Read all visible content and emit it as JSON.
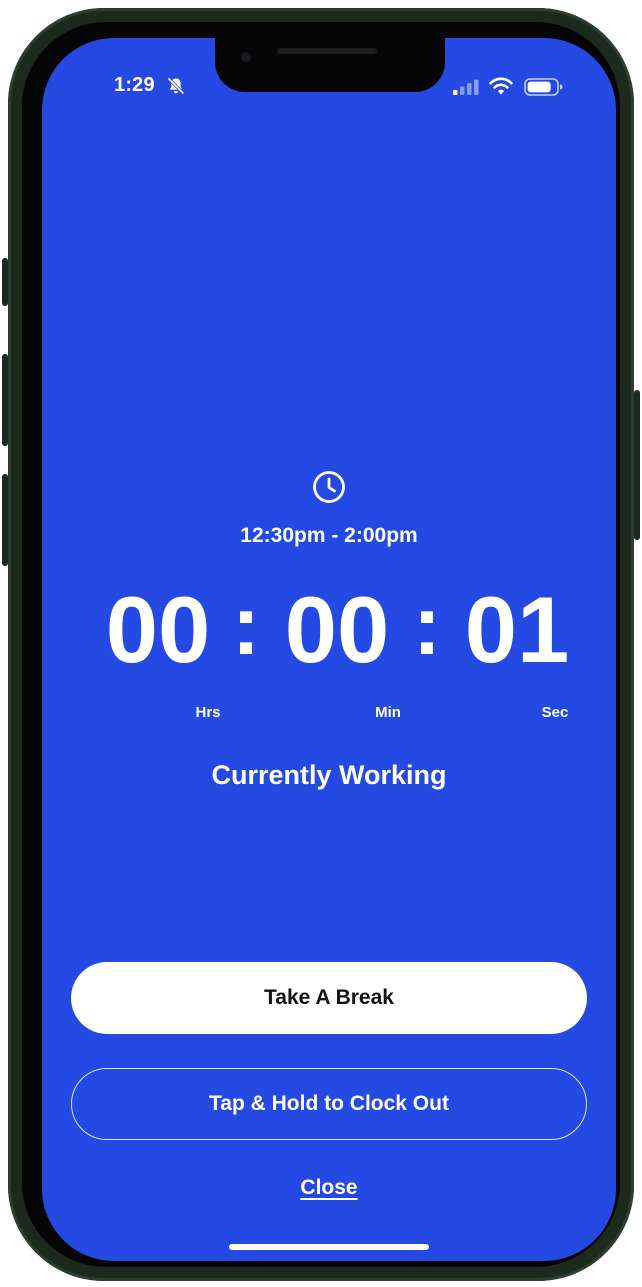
{
  "status_bar": {
    "time": "1:29",
    "icons": [
      "bell-slash-icon",
      "cellular-signal-icon",
      "wifi-icon",
      "battery-icon"
    ]
  },
  "shift": {
    "icon": "clock-icon",
    "schedule": "12:30pm - 2:00pm"
  },
  "timer": {
    "hours": "00",
    "minutes": "00",
    "seconds": "01",
    "separator": ":",
    "hours_label": "Hrs",
    "minutes_label": "Min",
    "seconds_label": "Sec"
  },
  "state_label": "Currently Working",
  "actions": {
    "break_label": "Take A Break",
    "clock_out_label": "Tap & Hold to Clock Out",
    "close_label": "Close"
  },
  "colors": {
    "background": "#2549e3",
    "text": "#ffffff",
    "primary_button_bg": "#ffffff",
    "primary_button_text": "#111111"
  }
}
